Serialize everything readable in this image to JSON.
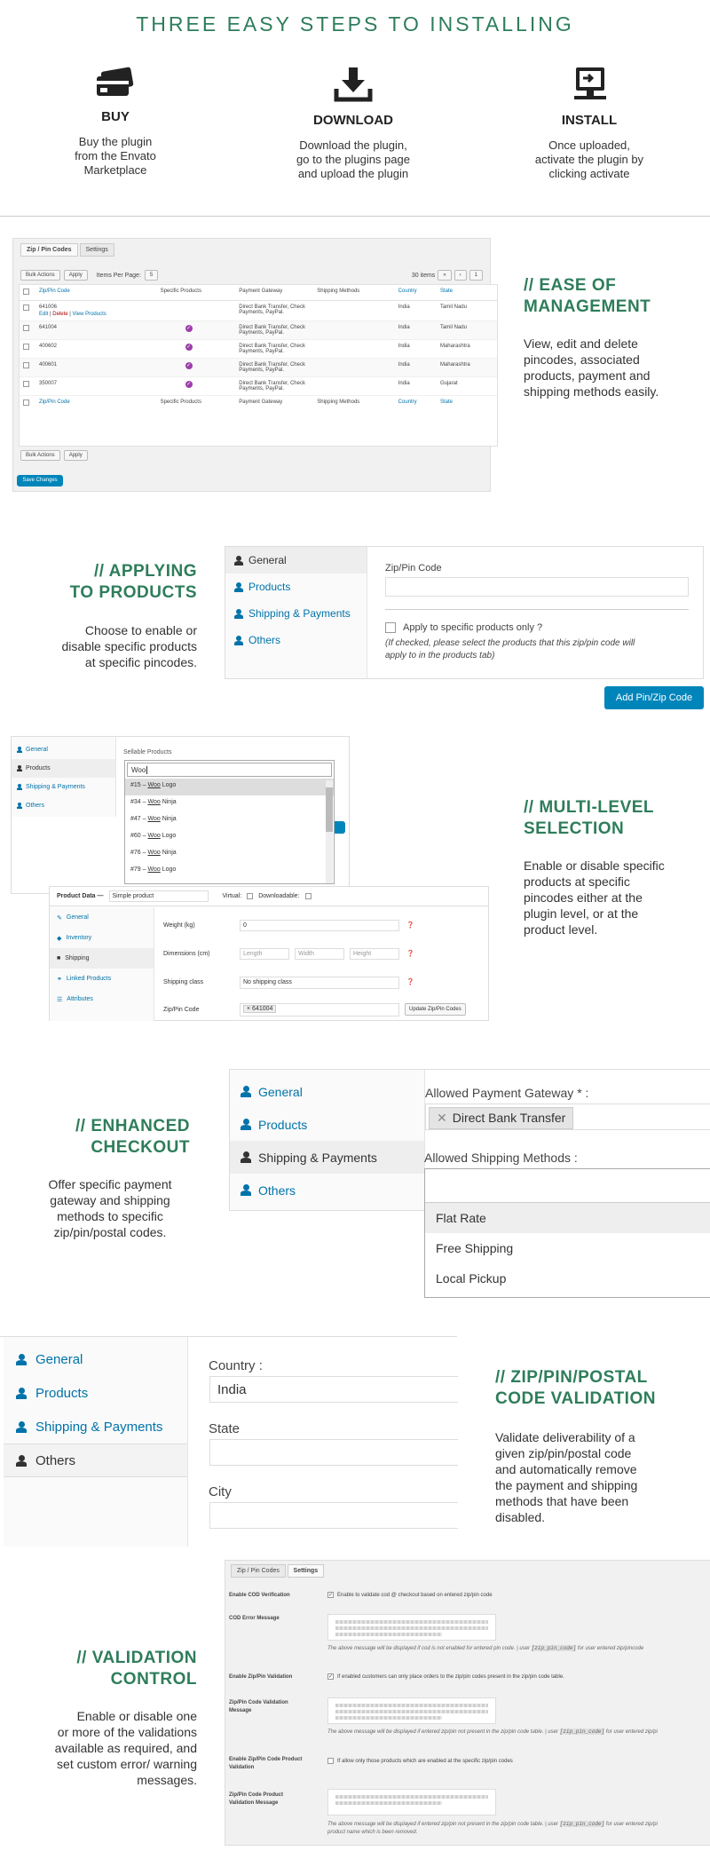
{
  "header": {
    "title": "THREE EASY STEPS TO INSTALLING"
  },
  "steps": [
    {
      "icon": "credit-card-icon",
      "title": "BUY",
      "desc_lines": [
        "Buy the plugin",
        "from the Envato",
        "Marketplace"
      ]
    },
    {
      "icon": "download-icon",
      "title": "DOWNLOAD",
      "desc_lines": [
        "Download the plugin,",
        "go to the plugins page",
        "and upload the plugin"
      ]
    },
    {
      "icon": "install-computer-icon",
      "title": "INSTALL",
      "desc_lines": [
        "Once uploaded,",
        "activate the plugin by",
        "clicking activate"
      ]
    }
  ],
  "colors": {
    "accent": "#2e7d5b",
    "wp_blue": "#0085ba",
    "link": "#0073aa",
    "tick": "#9b3fa8"
  },
  "f1": {
    "heading": [
      "//  EASE OF",
      "MANAGEMENT"
    ],
    "desc": [
      "View, edit and delete",
      "pincodes, associated",
      "products, payment and",
      "shipping methods easily."
    ],
    "tabs": [
      "Zip / Pin Codes",
      "Settings"
    ],
    "bulk": "Bulk Actions",
    "apply": "Apply",
    "items_per_page": "Items Per Page:",
    "ipp_value": "5",
    "items_count": "30 items",
    "pager": [
      "«",
      "‹",
      "1"
    ],
    "columns": [
      "Zip/Pin Code",
      "Specific Products",
      "Payment Gateway",
      "Shipping Methods",
      "Country",
      "State"
    ],
    "footer_columns": [
      "Zip/Pin Code",
      "Specific Products",
      "Payment Gateway",
      "Shipping Methods",
      "Country",
      "State"
    ],
    "row_actions": [
      "Edit",
      "Delete",
      "View Products"
    ],
    "rows": [
      {
        "code": "641006",
        "gateway": "Direct Bank Transfer, Check Payments, PayPal.",
        "country": "India",
        "state": "Tamil Nadu",
        "tick": false
      },
      {
        "code": "641004",
        "gateway": "Direct Bank Transfer, Check Payments, PayPal.",
        "country": "India",
        "state": "Tamil Nadu",
        "tick": true
      },
      {
        "code": "400602",
        "gateway": "Direct Bank Transfer, Check Payments, PayPal.",
        "country": "India",
        "state": "Maharashtra",
        "tick": true
      },
      {
        "code": "400601",
        "gateway": "Direct Bank Transfer, Check Payments, PayPal.",
        "country": "India",
        "state": "Maharashtra",
        "tick": true
      },
      {
        "code": "350007",
        "gateway": "Direct Bank Transfer, Check Payments, PayPal.",
        "country": "India",
        "state": "Gujarat",
        "tick": true
      }
    ],
    "save": "Save Changes"
  },
  "f2": {
    "heading": [
      "//  APPLYING",
      "TO PRODUCTS"
    ],
    "desc": [
      "Choose to enable or",
      "disable specific products",
      "at specific pincodes."
    ],
    "nav": [
      "General",
      "Products",
      "Shipping & Payments",
      "Others"
    ],
    "zip_label": "Zip/Pin Code",
    "checkbox_label": "Apply to specific products only ?",
    "note": [
      "(If checked, please select the products that this zip/pin code will",
      "apply to in the products tab)"
    ],
    "add_button": "Add Pin/Zip Code"
  },
  "f3": {
    "heading": [
      "//  MULTI-LEVEL",
      "SELECTION"
    ],
    "desc": [
      "Enable or disable specific",
      "products at specific",
      "pincodes either at the",
      "plugin level, or at the",
      "product level."
    ],
    "nav": [
      "General",
      "Products",
      "Shipping & Payments",
      "Others"
    ],
    "sellable_label": "Sellable Products",
    "search_value": "Woo",
    "options": [
      {
        "num": "#15 – ",
        "m": "Woo",
        "rest": " Logo"
      },
      {
        "num": "#34 – ",
        "m": "Woo",
        "rest": " Ninja"
      },
      {
        "num": "#47 – ",
        "m": "Woo",
        "rest": " Ninja"
      },
      {
        "num": "#60 – ",
        "m": "Woo",
        "rest": " Logo"
      },
      {
        "num": "#76 – ",
        "m": "Woo",
        "rest": " Ninja"
      },
      {
        "num": "#79 – ",
        "m": "Woo",
        "rest": " Logo"
      }
    ],
    "pd_label": "Product Data —",
    "pd_type": "Simple product",
    "virtual": "Virtual:",
    "downloadable": "Downloadable:",
    "pd_tabs": [
      "General",
      "Inventory",
      "Shipping",
      "Linked Products",
      "Attributes"
    ],
    "weight_label": "Weight (kg)",
    "weight_value": "0",
    "dims_label": "Dimensions (cm)",
    "dims_ph": [
      "Length",
      "Width",
      "Height"
    ],
    "ship_class_label": "Shipping class",
    "ship_class_value": "No shipping class",
    "zip_label": "Zip/Pin Code",
    "zip_tag": "641004",
    "update_btn": "Update Zip/Pin Codes"
  },
  "f4": {
    "heading": [
      "//  ENHANCED",
      "CHECKOUT"
    ],
    "desc": [
      "Offer specific payment",
      "gateway and shipping",
      "methods to specific",
      "zip/pin/postal codes."
    ],
    "nav": [
      "General",
      "Products",
      "Shipping & Payments",
      "Others"
    ],
    "gateway_label": "Allowed Payment Gateway * :",
    "gateway_tag": "Direct Bank Transfer",
    "ship_label": "Allowed Shipping Methods :",
    "ship_options": [
      "Flat Rate",
      "Free Shipping",
      "Local Pickup"
    ]
  },
  "f5": {
    "heading": [
      "//  ZIP/PIN/POSTAL",
      "CODE VALIDATION"
    ],
    "desc": [
      "Validate deliverability of a",
      "given zip/pin/postal code",
      "and automatically remove",
      "the payment and shipping",
      "methods that have been",
      "disabled."
    ],
    "nav": [
      "General",
      "Products",
      "Shipping & Payments",
      "Others"
    ],
    "country_label": "Country :",
    "country_value": "India",
    "state_label": "State",
    "city_label": "City"
  },
  "f6": {
    "heading": [
      "//  VALIDATION",
      "CONTROL"
    ],
    "desc": [
      "Enable or disable one",
      "or more of the validations",
      "available as required, and",
      "set custom error/ warning",
      "messages."
    ],
    "tabs": [
      "Zip / Pin Codes",
      "Settings"
    ],
    "s1_label": "Enable COD Verification",
    "s1_text": "Enable to validate cod @ checkout based on entered zip/pin code",
    "s2_label": "COD Error Message",
    "s2_help_a": "The above message will be displayed if cod is not enabled for entered pin code. | user ",
    "s2_code": "[zip_pin_code]",
    "s2_help_b": " for user entered zip/pincode",
    "s3_label": "Enable Zip/Pin Validation",
    "s3_text": "If enabled customers can only place orders to the zip/pin codes present in the zip/pin code table.",
    "s4_label": [
      "Zip/Pin Code Validation",
      "Message"
    ],
    "s4_help_a": "The above message will be displayed if entered zip/pin not present in the zip/pin code table. | user ",
    "s4_code": "[zip_pin_code]",
    "s4_help_b": " for user entered zip/pi",
    "s5_label": [
      "Enable Zip/Pin Code Product",
      "Validation"
    ],
    "s5_text": "If allow only those products which are enabled at the specific zip/pin codes",
    "s6_label": [
      "Zip/Pin Code Product",
      "Validation Message"
    ],
    "s6_help_a": "The above message will be displayed if entered zip/pin not present in the zip/pin code table. | user ",
    "s6_code": "[zip_pin_code]",
    "s6_help_b": " for user entered zip/pi",
    "s6_help_c": "product name which is been removed."
  }
}
